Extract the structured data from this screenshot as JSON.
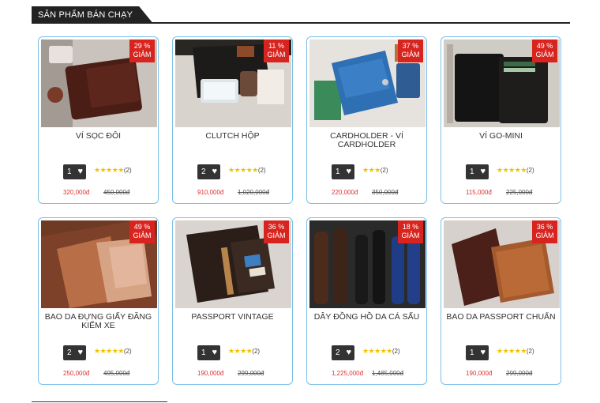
{
  "section": {
    "title": "SẢN PHẨM BÁN CHẠY"
  },
  "discount_word": "GIẢM",
  "products": [
    {
      "name": "VÍ SỌC ĐÔI",
      "discount": "29 %",
      "qty": "1",
      "stars": 5,
      "reviews": "(2)",
      "price": "320,000đ",
      "old_price": "450,000đ",
      "image": "wallet-brown-photo"
    },
    {
      "name": "CLUTCH HỘP",
      "discount": "11 %",
      "qty": "2",
      "stars": 5,
      "reviews": "(2)",
      "price": "910,000đ",
      "old_price": "1,020,000đ",
      "image": "clutch-black-photo"
    },
    {
      "name": "CARDHOLDER - VÍ CARDHOLDER",
      "discount": "37 %",
      "qty": "1",
      "stars": 3,
      "reviews": "(2)",
      "price": "220,000đ",
      "old_price": "350,000đ",
      "image": "cardholder-blue-photo"
    },
    {
      "name": "VÍ GO-MINI",
      "discount": "49 %",
      "qty": "1",
      "stars": 5,
      "reviews": "(2)",
      "price": "115,000đ",
      "old_price": "225,000đ",
      "image": "mini-wallet-black-photo"
    },
    {
      "name": "BAO DA ĐỰNG GIẤY ĐĂNG KIỂM XE",
      "discount": "49 %",
      "qty": "2",
      "stars": 5,
      "reviews": "(2)",
      "price": "250,000đ",
      "old_price": "495,000đ",
      "image": "document-holder-photo"
    },
    {
      "name": "PASSPORT VINTAGE",
      "discount": "36 %",
      "qty": "1",
      "stars": 4,
      "reviews": "(2)",
      "price": "190,000đ",
      "old_price": "299,000đ",
      "image": "passport-vintage-photo"
    },
    {
      "name": "DÂY ĐỒNG HỒ DA CÁ SẤU",
      "discount": "18 %",
      "qty": "2",
      "stars": 5,
      "reviews": "(2)",
      "price": "1,225,000đ",
      "old_price": "1,485,000đ",
      "image": "watch-straps-photo"
    },
    {
      "name": "BAO DA PASSPORT CHUẨN",
      "discount": "36 %",
      "qty": "1",
      "stars": 5,
      "reviews": "(2)",
      "price": "190,000đ",
      "old_price": "299,000đ",
      "image": "passport-brown-photo"
    }
  ],
  "colors": {
    "accent": "#d8241f",
    "card_border": "#7cc0e8",
    "price": "#e03131",
    "star": "#f2c200"
  }
}
